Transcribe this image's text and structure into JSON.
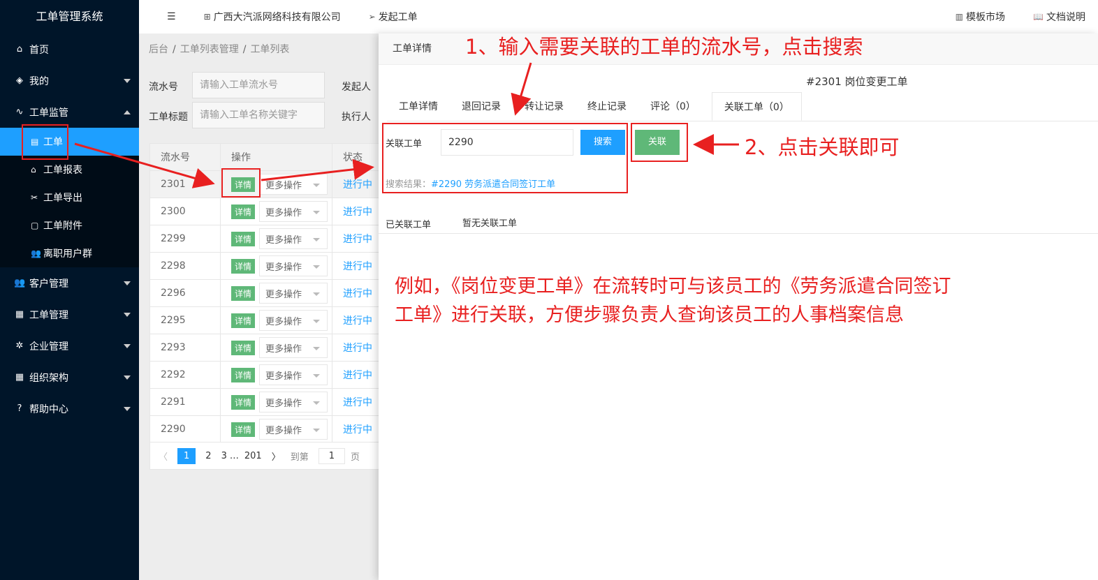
{
  "sidebar": {
    "logo": "工单管理系统",
    "items": [
      {
        "label": "首页",
        "icon": "home-icon"
      },
      {
        "label": "我的",
        "icon": "layers-icon"
      },
      {
        "label": "工单监管",
        "icon": "pulse-icon"
      }
    ],
    "sub_items": [
      {
        "label": "工单",
        "icon": "document-icon"
      },
      {
        "label": "工单报表",
        "icon": "home-outline-icon"
      },
      {
        "label": "工单导出",
        "icon": "scissors-icon"
      },
      {
        "label": "工单附件",
        "icon": "file-icon"
      },
      {
        "label": "离职用户群",
        "icon": "users-icon"
      }
    ],
    "bottom_items": [
      {
        "label": "客户管理",
        "icon": "users-icon"
      },
      {
        "label": "工单管理",
        "icon": "clipboard-icon"
      },
      {
        "label": "企业管理",
        "icon": "gear-icon"
      },
      {
        "label": "组织架构",
        "icon": "calendar-icon"
      },
      {
        "label": "帮助中心",
        "icon": "question-icon"
      }
    ]
  },
  "topbar": {
    "menu_toggle": "☰",
    "company": "广西大汽派网络科技有限公司",
    "start_ticket": "发起工单",
    "template_market": "模板市场",
    "docs": "文档说明"
  },
  "list": {
    "breadcrumb": [
      "后台",
      "工单列表管理",
      "工单列表"
    ],
    "serial_label": "流水号",
    "serial_placeholder": "请输入工单流水号",
    "initiator_label": "发起人",
    "title_label": "工单标题",
    "title_placeholder": "请输入工单名称关键字",
    "executor_label": "执行人",
    "columns": [
      "流水号",
      "操作",
      "状态"
    ],
    "detail_label": "详情",
    "more_label": "更多操作",
    "rows": [
      {
        "id": "2301",
        "status": "进行中"
      },
      {
        "id": "2300",
        "status": "进行中"
      },
      {
        "id": "2299",
        "status": "进行中"
      },
      {
        "id": "2298",
        "status": "进行中"
      },
      {
        "id": "2296",
        "status": "进行中"
      },
      {
        "id": "2295",
        "status": "进行中"
      },
      {
        "id": "2293",
        "status": "进行中"
      },
      {
        "id": "2292",
        "status": "进行中"
      },
      {
        "id": "2291",
        "status": "进行中"
      },
      {
        "id": "2290",
        "status": "进行中"
      }
    ],
    "pager": {
      "prev": "〈",
      "p1": "1",
      "p2": "2",
      "p3": "3",
      "ellipsis": "…",
      "last": "201",
      "next": "〉",
      "goto": "到第",
      "goto_value": "1",
      "page_suffix": "页"
    }
  },
  "panel": {
    "header": "工单详情",
    "title": "#2301 岗位变更工单",
    "tabs": [
      "工单详情",
      "退回记录",
      "转让记录",
      "终止记录",
      "评论（0）",
      "关联工单（0）"
    ],
    "relate_label": "关联工单",
    "relate_value": "2290",
    "search_btn": "搜索",
    "link_btn": "关联",
    "result_prefix": "搜索结果：",
    "result_link": "#2290 劳务派遣合同签订工单",
    "linked_label": "已关联工单",
    "linked_none": "暂无关联工单"
  },
  "annotations": {
    "step1": "1、输入需要关联的工单的流水号，点击搜索",
    "step2": "2、点击关联即可",
    "example": "例如，《岗位变更工单》在流转时可与该员工的《劳务派遣合同签订工单》进行关联，方便步骤负责人查询该员工的人事档案信息",
    "color": "#e82020"
  }
}
